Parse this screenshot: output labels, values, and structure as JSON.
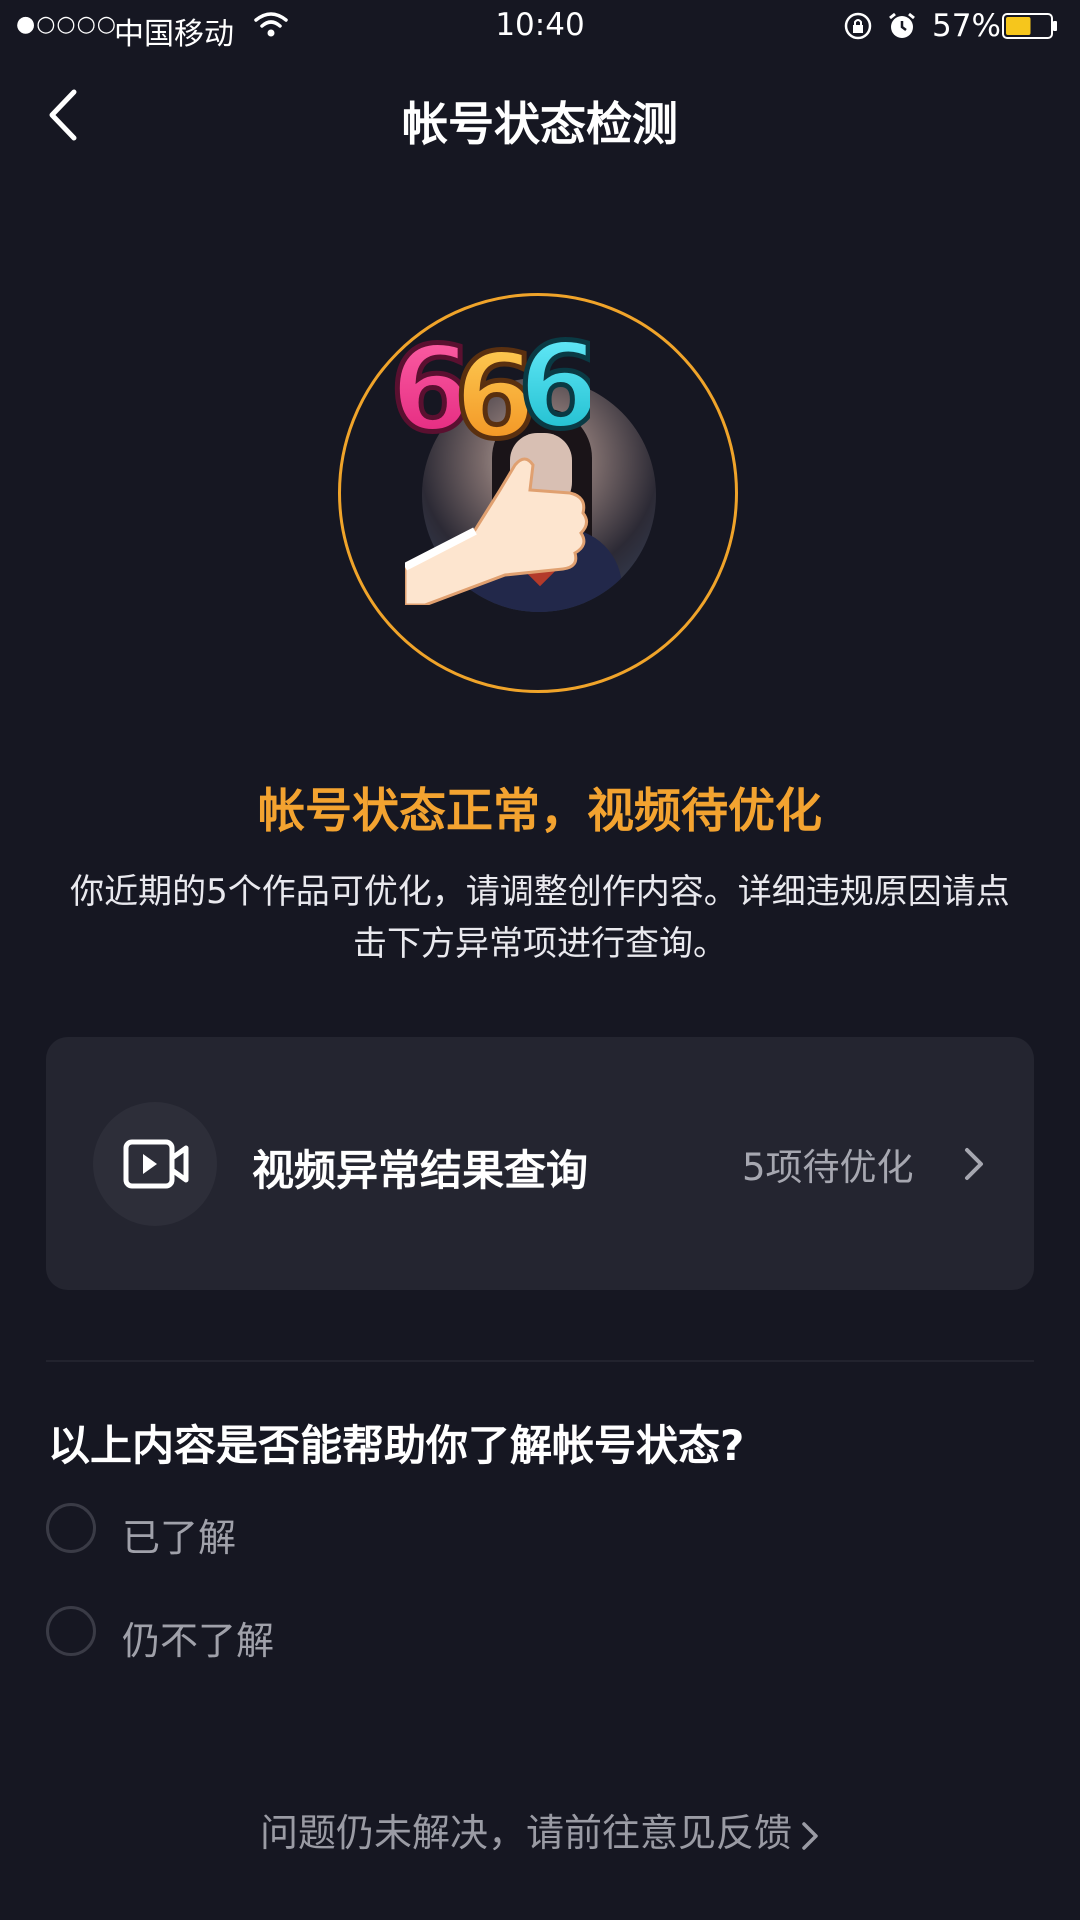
{
  "status_bar": {
    "signal": "●○○○○",
    "carrier": "中国移动",
    "time": "10:40",
    "battery": "57%",
    "battery_level": 0.57,
    "battery_color": "#f6c61c",
    "icons": [
      "wifi-icon",
      "orientation-lock-icon",
      "alarm-icon",
      "battery-icon"
    ]
  },
  "nav": {
    "back_icon": "back-chevron-icon",
    "title": "帐号状态检测"
  },
  "avatar": {
    "sticker_text": "666",
    "ring_color": "#f0a42a"
  },
  "headline": "帐号状态正常，视频待优化",
  "description": "你近期的5个作品可优化，请调整创作内容。详细违规原因请点击下方异常项进行查询。",
  "card": {
    "icon": "video-icon",
    "title": "视频异常结果查询",
    "status": "5项待优化",
    "chevron_icon": "chevron-right-icon"
  },
  "survey": {
    "question": "以上内容是否能帮助你了解帐号状态?",
    "options": [
      "已了解",
      "仍不了解"
    ]
  },
  "feedback": {
    "text": "问题仍未解决，请前往意见反馈"
  },
  "colors": {
    "background": "#161722",
    "accent": "#f3a330",
    "card": "#242530"
  }
}
